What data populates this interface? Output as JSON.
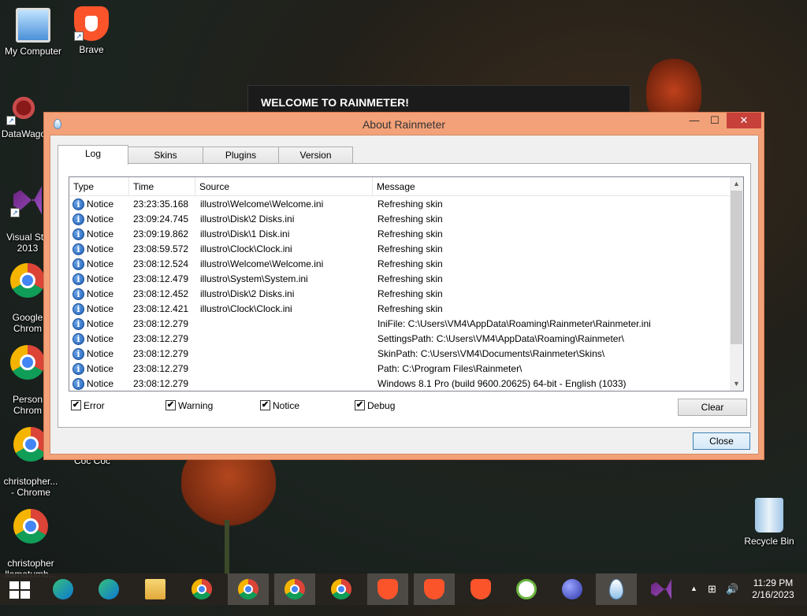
{
  "desktop": {
    "icons": [
      {
        "label": "My Computer"
      },
      {
        "label": "Brave"
      },
      {
        "label": "DataWago"
      },
      {
        "label": "Visual Stu\n2013"
      },
      {
        "label": "Google\nChrom"
      },
      {
        "label": "Person\nChrom"
      },
      {
        "label": "christopher...\n- Chrome"
      },
      {
        "label": "Coc Coc"
      },
      {
        "label": "christopher\nllamatumb..."
      },
      {
        "label": "Recycle Bin"
      }
    ]
  },
  "welcome": {
    "title": "WELCOME TO RAINMETER!"
  },
  "window": {
    "title": "About Rainmeter",
    "min_glyph": "—",
    "max_glyph": "☐",
    "close_glyph": "✕",
    "tabs": [
      "Log",
      "Skins",
      "Plugins",
      "Version"
    ],
    "columns": [
      "Type",
      "Time",
      "Source",
      "Message"
    ],
    "rows": [
      {
        "type": "Notice",
        "time": "23:23:35.168",
        "source": "illustro\\Welcome\\Welcome.ini",
        "message": "Refreshing skin"
      },
      {
        "type": "Notice",
        "time": "23:09:24.745",
        "source": "illustro\\Disk\\2 Disks.ini",
        "message": "Refreshing skin"
      },
      {
        "type": "Notice",
        "time": "23:09:19.862",
        "source": "illustro\\Disk\\1 Disk.ini",
        "message": "Refreshing skin"
      },
      {
        "type": "Notice",
        "time": "23:08:59.572",
        "source": "illustro\\Clock\\Clock.ini",
        "message": "Refreshing skin"
      },
      {
        "type": "Notice",
        "time": "23:08:12.524",
        "source": "illustro\\Welcome\\Welcome.ini",
        "message": "Refreshing skin"
      },
      {
        "type": "Notice",
        "time": "23:08:12.479",
        "source": "illustro\\System\\System.ini",
        "message": "Refreshing skin"
      },
      {
        "type": "Notice",
        "time": "23:08:12.452",
        "source": "illustro\\Disk\\2 Disks.ini",
        "message": "Refreshing skin"
      },
      {
        "type": "Notice",
        "time": "23:08:12.421",
        "source": "illustro\\Clock\\Clock.ini",
        "message": "Refreshing skin"
      },
      {
        "type": "Notice",
        "time": "23:08:12.279",
        "source": "",
        "message": "IniFile: C:\\Users\\VM4\\AppData\\Roaming\\Rainmeter\\Rainmeter.ini"
      },
      {
        "type": "Notice",
        "time": "23:08:12.279",
        "source": "",
        "message": "SettingsPath: C:\\Users\\VM4\\AppData\\Roaming\\Rainmeter\\"
      },
      {
        "type": "Notice",
        "time": "23:08:12.279",
        "source": "",
        "message": "SkinPath: C:\\Users\\VM4\\Documents\\Rainmeter\\Skins\\"
      },
      {
        "type": "Notice",
        "time": "23:08:12.279",
        "source": "",
        "message": "Path: C:\\Program Files\\Rainmeter\\"
      },
      {
        "type": "Notice",
        "time": "23:08:12.279",
        "source": "",
        "message": "Windows 8.1 Pro (build 9600.20625) 64-bit - English (1033)"
      }
    ],
    "filters": [
      {
        "label": "Error",
        "checked": true
      },
      {
        "label": "Warning",
        "checked": true
      },
      {
        "label": "Notice",
        "checked": true
      },
      {
        "label": "Debug",
        "checked": true
      }
    ],
    "clear_label": "Clear",
    "close_label": "Close",
    "row_icon": "info-icon",
    "check_glyph": "✔",
    "scroll_up_glyph": "▲",
    "scroll_down_glyph": "▼"
  },
  "taskbar": {
    "apps": [
      "start",
      "edge",
      "edge-beta",
      "file-explorer",
      "chrome",
      "chrome-profile-1",
      "chrome-profile-2",
      "chrome-profile-3",
      "brave-profile-1",
      "brave",
      "brave-profile-2",
      "coc-coc",
      "ball-app",
      "rainmeter",
      "visual-studio"
    ],
    "caret_glyph": "▲",
    "network_glyph": "⊞",
    "volume_glyph": "🔊",
    "time": "11:29 PM",
    "date": "2/16/2023"
  },
  "colors": {
    "window_frame": "#f3a178",
    "close_button": "#c7403a",
    "taskbar": "#28241e"
  }
}
